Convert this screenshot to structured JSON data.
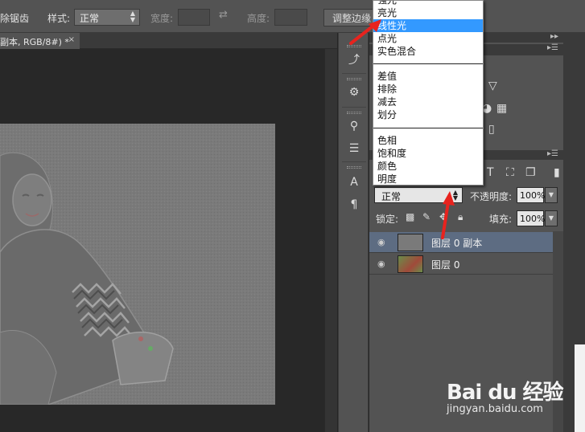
{
  "options_bar": {
    "remove_jaggies": "除锯齿",
    "style_label": "样式:",
    "style_value": "正常",
    "width_label": "宽度:",
    "height_label": "高度:",
    "refine_edge_button": "调整边缘"
  },
  "document_tab": {
    "title": "副本, RGB/8#) *",
    "close_glyph": "×"
  },
  "blend_dropdown": {
    "items_group1": [
      "强光",
      "亮光",
      "线性光",
      "点光",
      "实色混合"
    ],
    "selected": "线性光",
    "items_group2": [
      "差值",
      "排除",
      "减去",
      "划分"
    ],
    "items_group3": [
      "色相",
      "饱和度",
      "颜色",
      "明度"
    ]
  },
  "layers_panel": {
    "blend_mode_value": "正常",
    "opacity_label": "不透明度:",
    "opacity_value": "100%",
    "lock_label": "锁定:",
    "fill_label": "填充:",
    "fill_value": "100%",
    "layers": [
      {
        "name": "图层 0 副本",
        "active": true
      },
      {
        "name": "图层 0",
        "active": false
      }
    ]
  },
  "watermark": {
    "brand": "Bai du 经验",
    "url": "jingyan.baidu.com"
  },
  "colors": {
    "selection_highlight": "#3399ff",
    "active_layer": "#5d6c82",
    "annotation_red": "#e8231e"
  }
}
